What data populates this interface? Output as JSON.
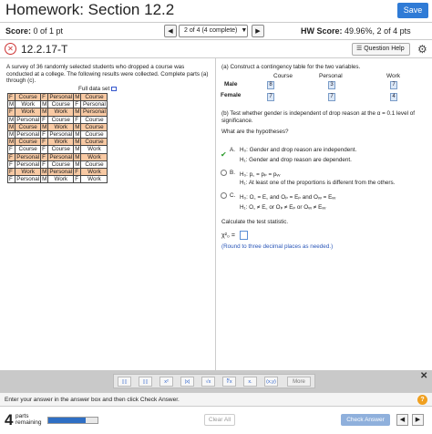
{
  "header": {
    "title": "Homework: Section 12.2",
    "save_label": "Save"
  },
  "scorebar": {
    "score_label": "Score:",
    "score_value": "0 of 1 pt",
    "question_select": "2 of 4 (4 complete)",
    "hw_score_label": "HW Score:",
    "hw_score_value": "49.96%, 2 of 4 pts"
  },
  "question": {
    "number": "12.2.17-T",
    "help_label": "Question Help"
  },
  "problem": {
    "text": "A survey of 36 randomly selected students who dropped a course was conducted at a college. The following results were collected. Complete parts (a) through (c).",
    "dataset_label": "Full data set",
    "rows": [
      {
        "c": [
          "F",
          "Course",
          "F",
          "Personal",
          "M",
          "Course"
        ],
        "hl": true
      },
      {
        "c": [
          "M",
          "Work",
          "M",
          "Course",
          "F",
          "Personal"
        ],
        "hl": false
      },
      {
        "c": [
          "F",
          "Work",
          "M",
          "Work",
          "M",
          "Personal"
        ],
        "hl": true
      },
      {
        "c": [
          "M",
          "Personal",
          "F",
          "Course",
          "F",
          "Course"
        ],
        "hl": false
      },
      {
        "c": [
          "M",
          "Course",
          "M",
          "Work",
          "M",
          "Course"
        ],
        "hl": true
      },
      {
        "c": [
          "M",
          "Personal",
          "F",
          "Personal",
          "M",
          "Course"
        ],
        "hl": false
      },
      {
        "c": [
          "M",
          "Course",
          "F",
          "Work",
          "M",
          "Course"
        ],
        "hl": true
      },
      {
        "c": [
          "F",
          "Course",
          "F",
          "Course",
          "M",
          "Work"
        ],
        "hl": false
      },
      {
        "c": [
          "F",
          "Personal",
          "F",
          "Personal",
          "M",
          "Work"
        ],
        "hl": true
      },
      {
        "c": [
          "F",
          "Personal",
          "F",
          "Course",
          "M",
          "Course"
        ],
        "hl": false
      },
      {
        "c": [
          "F",
          "Work",
          "M",
          "Personal",
          "F",
          "Work"
        ],
        "hl": true
      },
      {
        "c": [
          "F",
          "Personal",
          "M",
          "Work",
          "F",
          "Work"
        ],
        "hl": false
      }
    ]
  },
  "part_a": {
    "text": "(a) Construct a contingency table for the two variables.",
    "columns": [
      "Course",
      "Personal",
      "Work"
    ],
    "rows": [
      {
        "label": "Male",
        "values": [
          "8",
          "3",
          "7"
        ]
      },
      {
        "label": "Female",
        "values": [
          "7",
          "7",
          "4"
        ]
      }
    ]
  },
  "part_b": {
    "text": "(b) Test whether gender is independent of drop reason at the α = 0.1 level of significance.",
    "hyp_question": "What are the hypotheses?",
    "options": [
      {
        "letter": "A.",
        "selected": true,
        "h0": "H₀: Gender and drop reason are independent.",
        "h1": "H₁: Gender and drop reason are dependent."
      },
      {
        "letter": "B.",
        "selected": false,
        "h0": "H₀: p꜀ = pₚ = pᵥᵥ",
        "h1": "H₁: At least one of the proportions is different from the others."
      },
      {
        "letter": "C.",
        "selected": false,
        "h0": "H₀: O꜀ = E꜀ and Oₚ = Eₚ and Oᵥᵥ = Eᵥᵥ",
        "h1": "H₁: O꜀ ≠ E꜀ or Oₚ ≠ Eₚ or Oᵥᵥ ≠ Eᵥᵥ"
      }
    ],
    "stat_question": "Calculate the test statistic.",
    "chi_label": "χ²₀ =",
    "round_note": "(Round to three decimal places as needed.)"
  },
  "toolbar": {
    "tools": [
      "▯▯",
      "▯▯",
      "x²",
      "|x|",
      "√x",
      "∛x",
      "x.",
      "(x,y)"
    ],
    "more_label": "More",
    "close": "✕"
  },
  "status": {
    "text": "Enter your answer in the answer box and then click Check Answer.",
    "help": "?"
  },
  "footer": {
    "parts_count": "4",
    "parts_label_1": "parts",
    "parts_label_2": "remaining",
    "progress": 0.75,
    "clear_label": "Clear All",
    "check_label": "Check Answer"
  },
  "colors": {
    "accent": "#2f7bd6",
    "highlight_row": "#f8c9a3",
    "check_green": "#2a9a2a",
    "note_blue": "#2a56b8"
  }
}
